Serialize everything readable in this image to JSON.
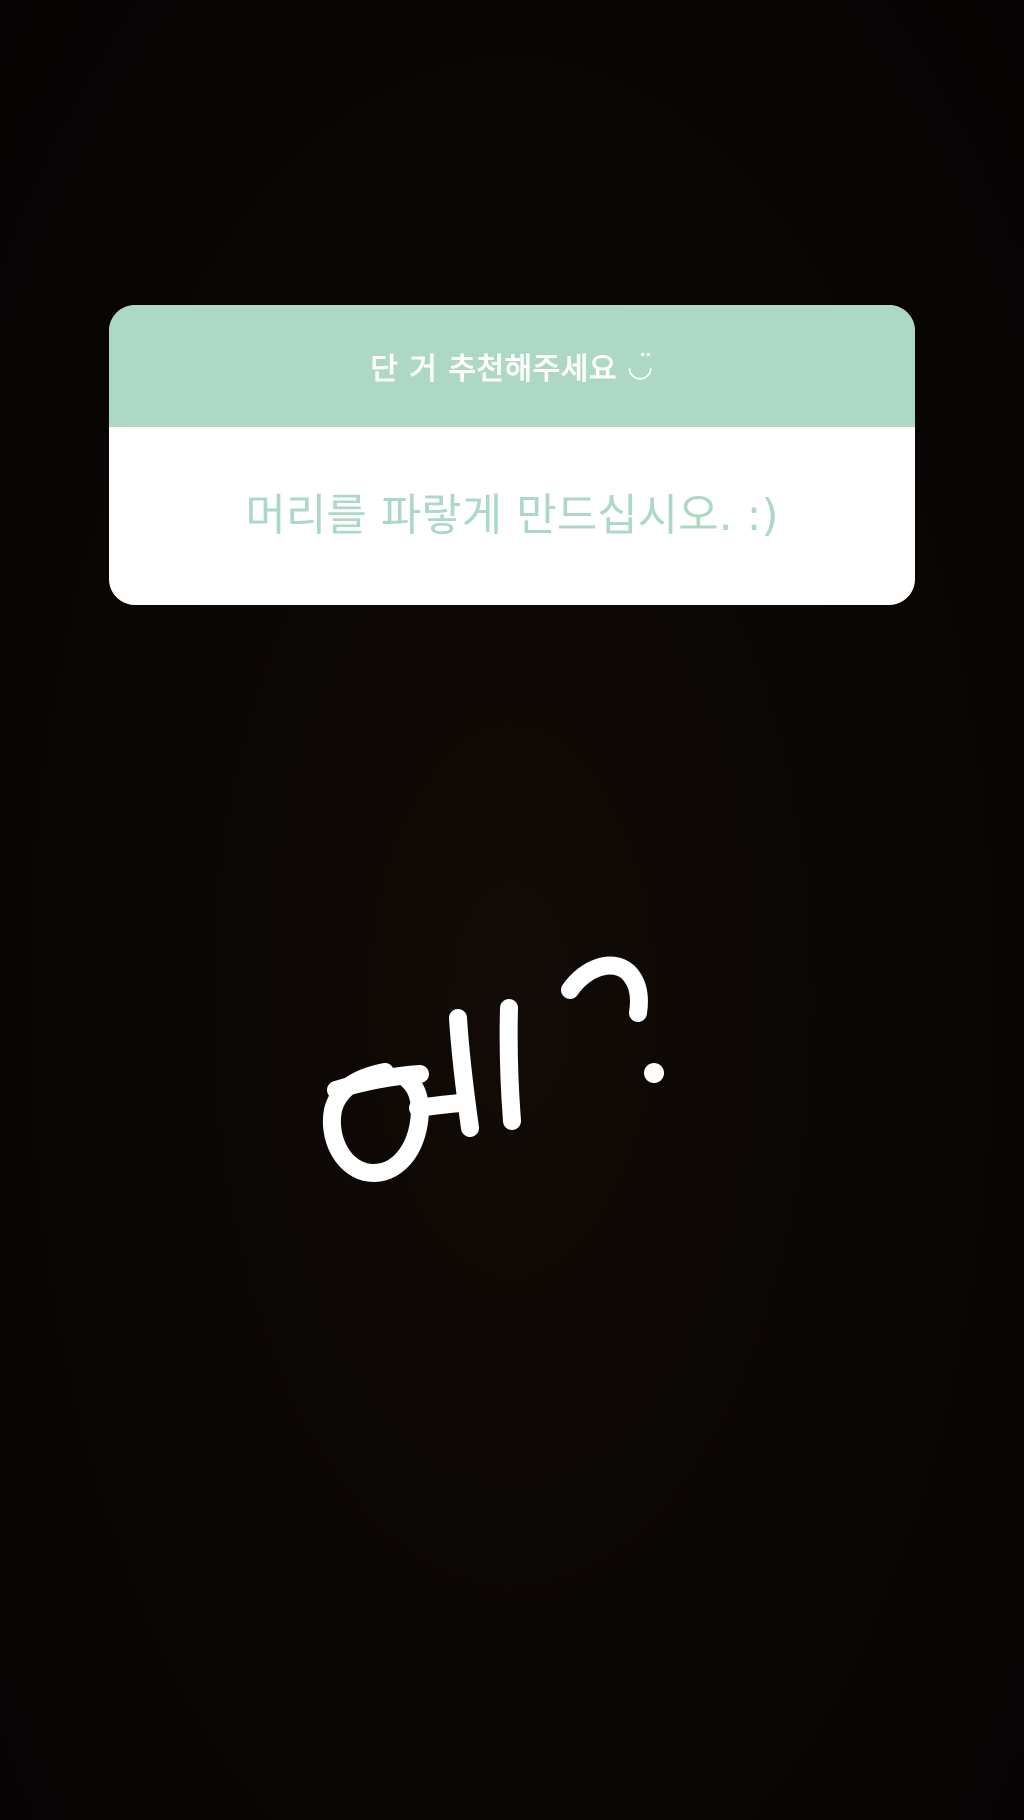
{
  "question": {
    "prompt": "단 거 추천해주세요",
    "prompt_emoji": "◡̈",
    "answer": "머리를 파랗게 만드십시오. :)"
  },
  "drawing": {
    "text": "예?",
    "color": "#ffffff"
  },
  "colors": {
    "card_accent": "#acd8c5",
    "card_body": "#ffffff",
    "background": "#0b0705"
  }
}
